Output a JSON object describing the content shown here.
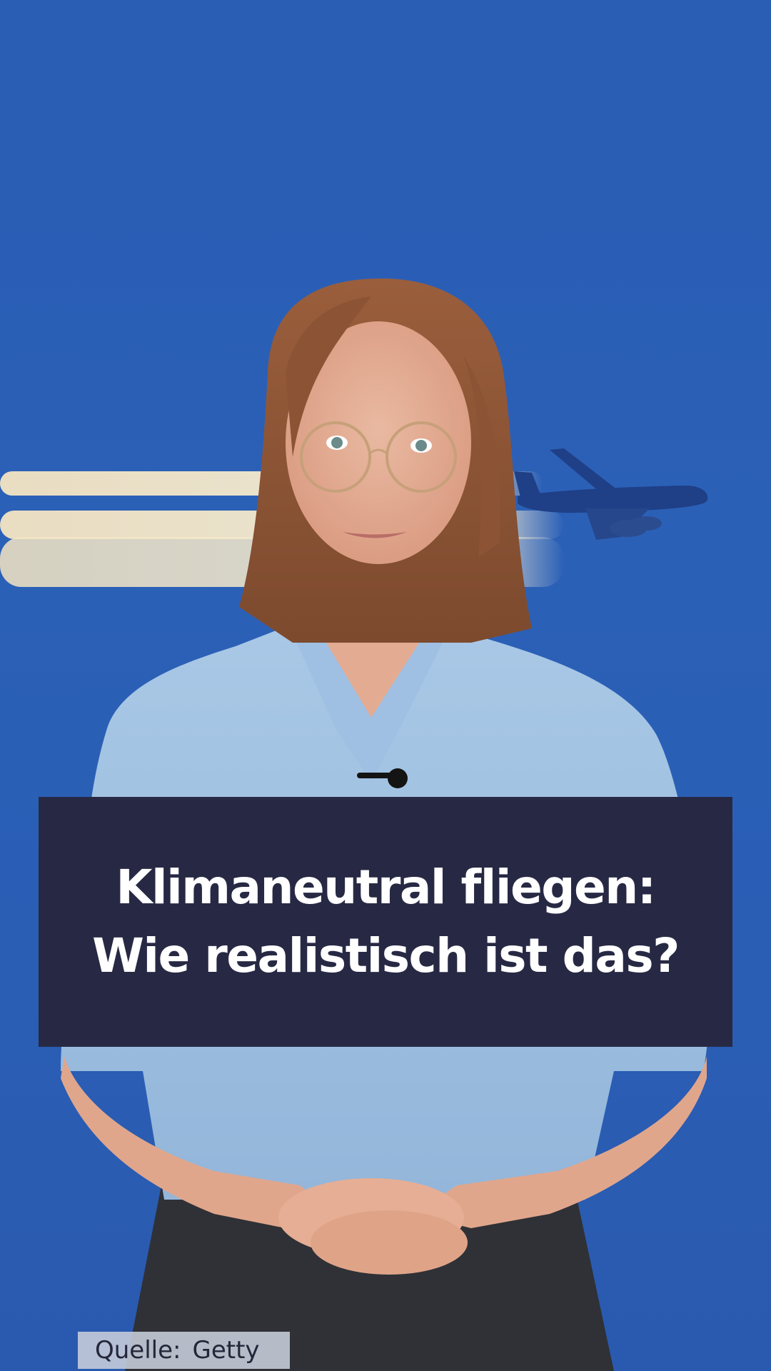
{
  "title": {
    "line1": "Klimaneutral fliegen:",
    "line2": "Wie realistisch ist das?"
  },
  "source": {
    "label": "Quelle:",
    "value": "Getty"
  },
  "colors": {
    "sky": "#2b60b7",
    "title_box": "#272944",
    "title_text": "#ffffff",
    "source_tag": "#c8cedc",
    "source_text": "#24263a"
  }
}
